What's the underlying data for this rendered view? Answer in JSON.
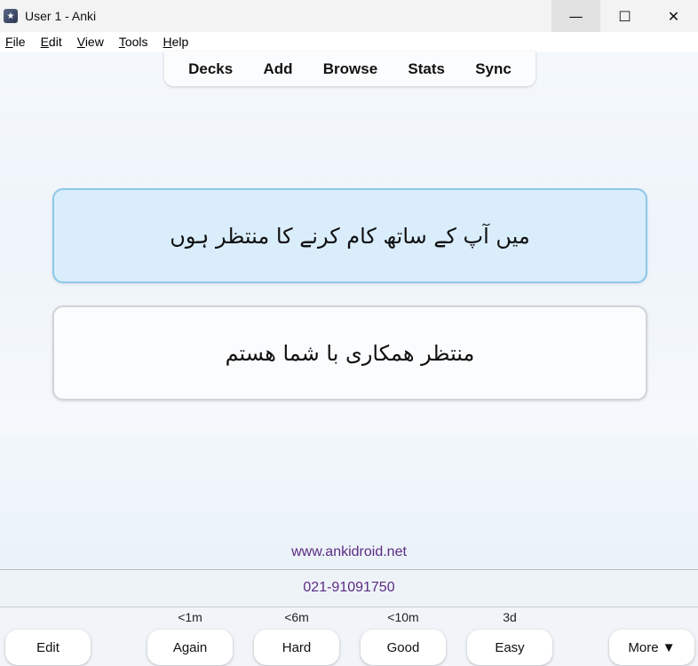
{
  "window": {
    "title": "User 1 - Anki",
    "minimize_glyph": "—",
    "maximize_glyph": "☐",
    "close_glyph": "✕"
  },
  "menu": {
    "file": {
      "underline": "F",
      "rest": "ile"
    },
    "edit": {
      "underline": "E",
      "rest": "dit"
    },
    "view": {
      "underline": "V",
      "rest": "iew"
    },
    "tools": {
      "underline": "T",
      "rest": "ools"
    },
    "help": {
      "underline": "H",
      "rest": "elp"
    }
  },
  "toolbar": {
    "decks": "Decks",
    "add": "Add",
    "browse": "Browse",
    "stats": "Stats",
    "sync": "Sync"
  },
  "card": {
    "front": "میں آپ کے ساتھ کام کرنے کا منتظر ہوں",
    "back": "منتظر همکاری با شما هستم"
  },
  "footer": {
    "url": "www.ankidroid.net",
    "phone": "021-91091750"
  },
  "answer": {
    "edit": "Edit",
    "again": {
      "label": "Again",
      "interval": "<1m"
    },
    "hard": {
      "label": "Hard",
      "interval": "<6m"
    },
    "good": {
      "label": "Good",
      "interval": "<10m"
    },
    "easy": {
      "label": "Easy",
      "interval": "3d"
    },
    "more": "More ▼"
  },
  "icons": {
    "app": "anki-star-icon",
    "minimize": "minimize-icon",
    "maximize": "maximize-icon",
    "close": "close-icon"
  }
}
